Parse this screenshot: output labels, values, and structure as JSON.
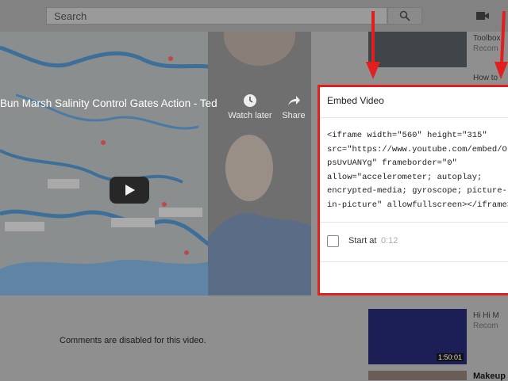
{
  "header": {
    "search_placeholder": "Search"
  },
  "player": {
    "title": "Bun Marsh Salinity Control Gates Action - Ted S...",
    "watch_later_label": "Watch later",
    "share_label": "Share"
  },
  "comments": {
    "disabled_text": "Comments are disabled for this video."
  },
  "embed": {
    "title": "Embed Video",
    "code_lines": [
      "<iframe width=\"560\" height=\"315\"",
      "src=\"https://www.youtube.com/embed/Ol",
      "psUvUANYg\" frameborder=\"0\"",
      "allow=\"accelerometer; autoplay;",
      "encrypted-media; gyroscope; picture-",
      "in-picture\" allowfullscreen></iframe>"
    ],
    "start_at_label": "Start at",
    "start_at_time": "0:12"
  },
  "sidebar": {
    "items": [
      {
        "title": "Toolbox",
        "subtitle": "Recom"
      },
      {
        "title": "How to"
      },
      {
        "title": "Hi Hi M",
        "subtitle": "Recom"
      },
      {
        "title": "Makeup M"
      }
    ],
    "durations": [
      "1:50:01"
    ]
  },
  "colors": {
    "highlight": "#e21f1f",
    "overlay": "#8f8f8f"
  },
  "icons": [
    "search-icon",
    "video-camera-icon",
    "clock-icon",
    "share-arrow-icon",
    "play-icon",
    "red-down-arrow"
  ]
}
